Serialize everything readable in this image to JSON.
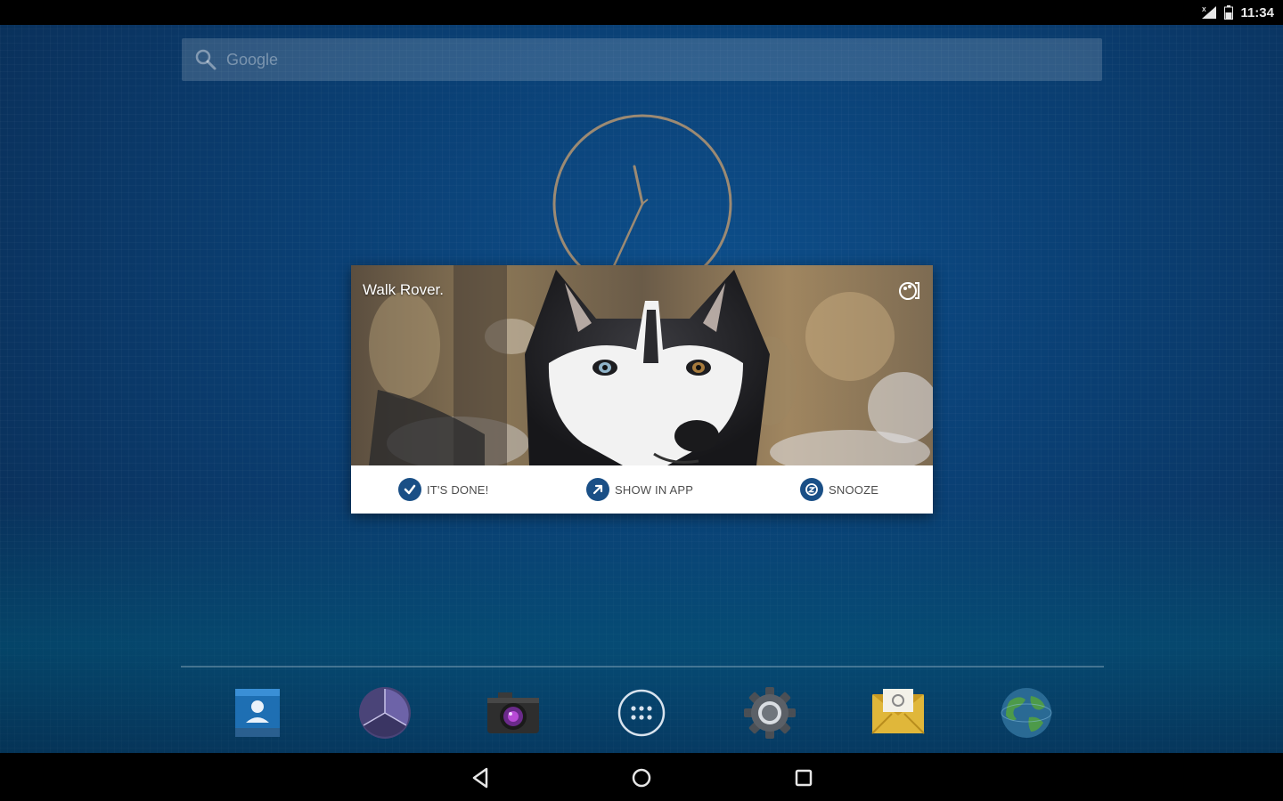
{
  "status_bar": {
    "time": "11:34"
  },
  "search": {
    "placeholder": "Google"
  },
  "notification": {
    "title": "Walk Rover.",
    "actions": [
      {
        "label": "IT'S DONE!",
        "icon": "check-icon"
      },
      {
        "label": "SHOW IN APP",
        "icon": "arrow-icon"
      },
      {
        "label": "SNOOZE",
        "icon": "snooze-icon"
      }
    ]
  },
  "dock": {
    "apps": [
      {
        "name": "contacts",
        "icon": "contacts-icon"
      },
      {
        "name": "gallery",
        "icon": "gallery-icon"
      },
      {
        "name": "camera",
        "icon": "camera-icon"
      },
      {
        "name": "apps",
        "icon": "app-drawer-icon"
      },
      {
        "name": "settings",
        "icon": "gear-icon"
      },
      {
        "name": "email",
        "icon": "email-icon"
      },
      {
        "name": "browser",
        "icon": "globe-icon"
      }
    ]
  },
  "nav": {
    "buttons": [
      "back-icon",
      "home-icon",
      "recents-icon"
    ]
  },
  "colors": {
    "accent": "#1a4f86",
    "clock_ring": "#9c8a73",
    "background": "#0a3f73"
  }
}
